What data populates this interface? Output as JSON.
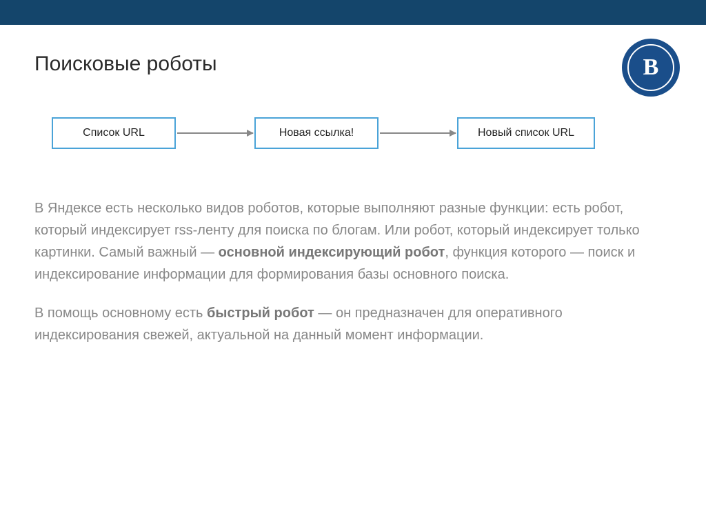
{
  "header": {
    "title": "Поисковые роботы",
    "logo_text": "В"
  },
  "diagram": {
    "box1": "Список URL",
    "box2": "Новая ссылка!",
    "box3": "Новый список URL"
  },
  "paragraphs": {
    "p1_a": "В Яндексе есть несколько видов роботов, которые выполняют разные функции: есть робот, который индексирует rss-ленту для поиска по блогам. Или робот, который индексирует только картинки. Самый важный — ",
    "p1_bold": "основной индексирующий робот",
    "p1_b": ", функция которого — поиск и индексирование информации для формирования базы основного поиска.",
    "p2_a": "В помощь основному есть ",
    "p2_bold": "быстрый робот",
    "p2_b": " — он предназначен для оперативного индексирования свежей, актуальной на данный момент информации."
  }
}
